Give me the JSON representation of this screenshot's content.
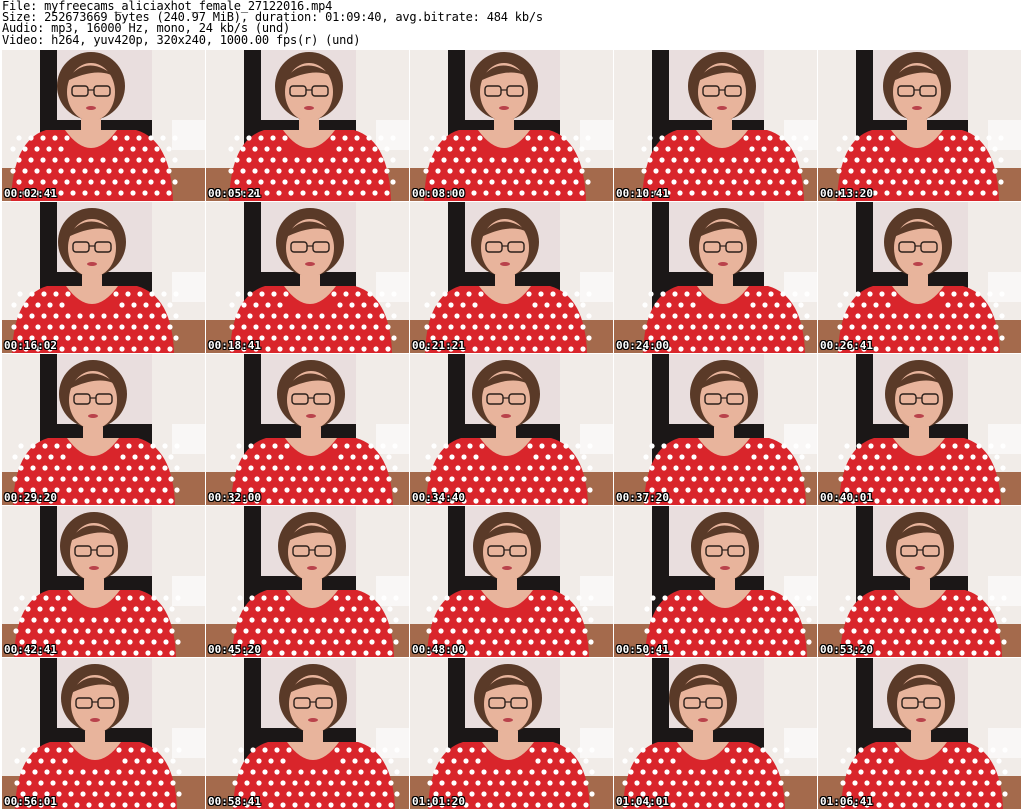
{
  "header": {
    "file_line": "File: myfreecams_aliciaxhot_female_27122016.mp4",
    "size_line": "Size: 252673669 bytes (240.97 MiB), duration: 01:09:40, avg.bitrate: 484 kb/s",
    "audio_line": "Audio: mp3, 16000 Hz, mono, 24 kb/s (und)",
    "video_line": "Video: h264, yuv420p, 320x240, 1000.00 fps(r) (und)"
  },
  "thumbnails": [
    {
      "timestamp": "00:02:41"
    },
    {
      "timestamp": "00:05:21"
    },
    {
      "timestamp": "00:08:00"
    },
    {
      "timestamp": "00:10:41"
    },
    {
      "timestamp": "00:13:20"
    },
    {
      "timestamp": "00:16:02"
    },
    {
      "timestamp": "00:18:41"
    },
    {
      "timestamp": "00:21:21"
    },
    {
      "timestamp": "00:24:00"
    },
    {
      "timestamp": "00:26:41"
    },
    {
      "timestamp": "00:29:20"
    },
    {
      "timestamp": "00:32:00"
    },
    {
      "timestamp": "00:34:40"
    },
    {
      "timestamp": "00:37:20"
    },
    {
      "timestamp": "00:40:01"
    },
    {
      "timestamp": "00:42:41"
    },
    {
      "timestamp": "00:45:20"
    },
    {
      "timestamp": "00:48:00"
    },
    {
      "timestamp": "00:50:41"
    },
    {
      "timestamp": "00:53:20"
    },
    {
      "timestamp": "00:56:01"
    },
    {
      "timestamp": "00:58:41"
    },
    {
      "timestamp": "01:01:20"
    },
    {
      "timestamp": "01:04:01"
    },
    {
      "timestamp": "01:06:41"
    }
  ],
  "colors": {
    "dress": "#d9252b",
    "dots": "#ffffff",
    "skin": "#e8b49c",
    "hair": "#5a3a28",
    "wall": "#f1ece8",
    "dark_wall": "#1b1717",
    "floor": "#a46a4c"
  }
}
